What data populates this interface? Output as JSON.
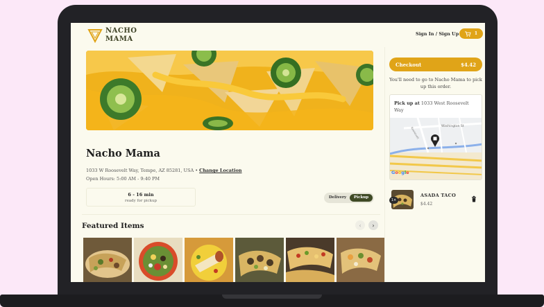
{
  "header": {
    "logo_line1": "NACHO",
    "logo_line2": "MAMA",
    "signin_label": "Sign In / Sign Up",
    "cart_count": "1"
  },
  "restaurant": {
    "name": "Nacho Mama",
    "address": "1033 W Roosevelt Way, Tempe, AZ 85281, USA",
    "address_sep": " • ",
    "change_location_label": "Change Location",
    "hours": "Open Hours: 5:00 AM - 9:40 PM",
    "eta_time": "6 - 16 min",
    "eta_sub": "ready for pickup"
  },
  "order_mode": {
    "options": [
      "Delivery",
      "Pickup"
    ],
    "selected": "Pickup"
  },
  "featured": {
    "title": "Featured Items",
    "prev_icon": "‹",
    "next_icon": "›",
    "items": [
      {
        "image": "tacos-platter"
      },
      {
        "image": "taco-salad-bowl"
      },
      {
        "image": "burrito-plate"
      },
      {
        "image": "carne-tacos"
      },
      {
        "image": "street-tacos"
      },
      {
        "image": "fish-tacos"
      }
    ]
  },
  "checkout": {
    "label": "Checkout",
    "total": "$4.42",
    "pickup_message": "You'll need to go to Nacho Mama to pick up this order.",
    "pickup_prefix": "Pick up at",
    "pickup_address": "1033 West Roosevelt Way",
    "map_street_1": "Washington St",
    "map_street_2": "Roosevelt",
    "map_brand": "Google"
  },
  "cart_items": [
    {
      "qty": "1×",
      "name": "ASADA TACO",
      "price": "$4.42"
    }
  ],
  "colors": {
    "accent": "#e0a418",
    "dark_olive": "#3f4a25",
    "background": "#fbfaee",
    "page_bg": "#fce8f8"
  }
}
